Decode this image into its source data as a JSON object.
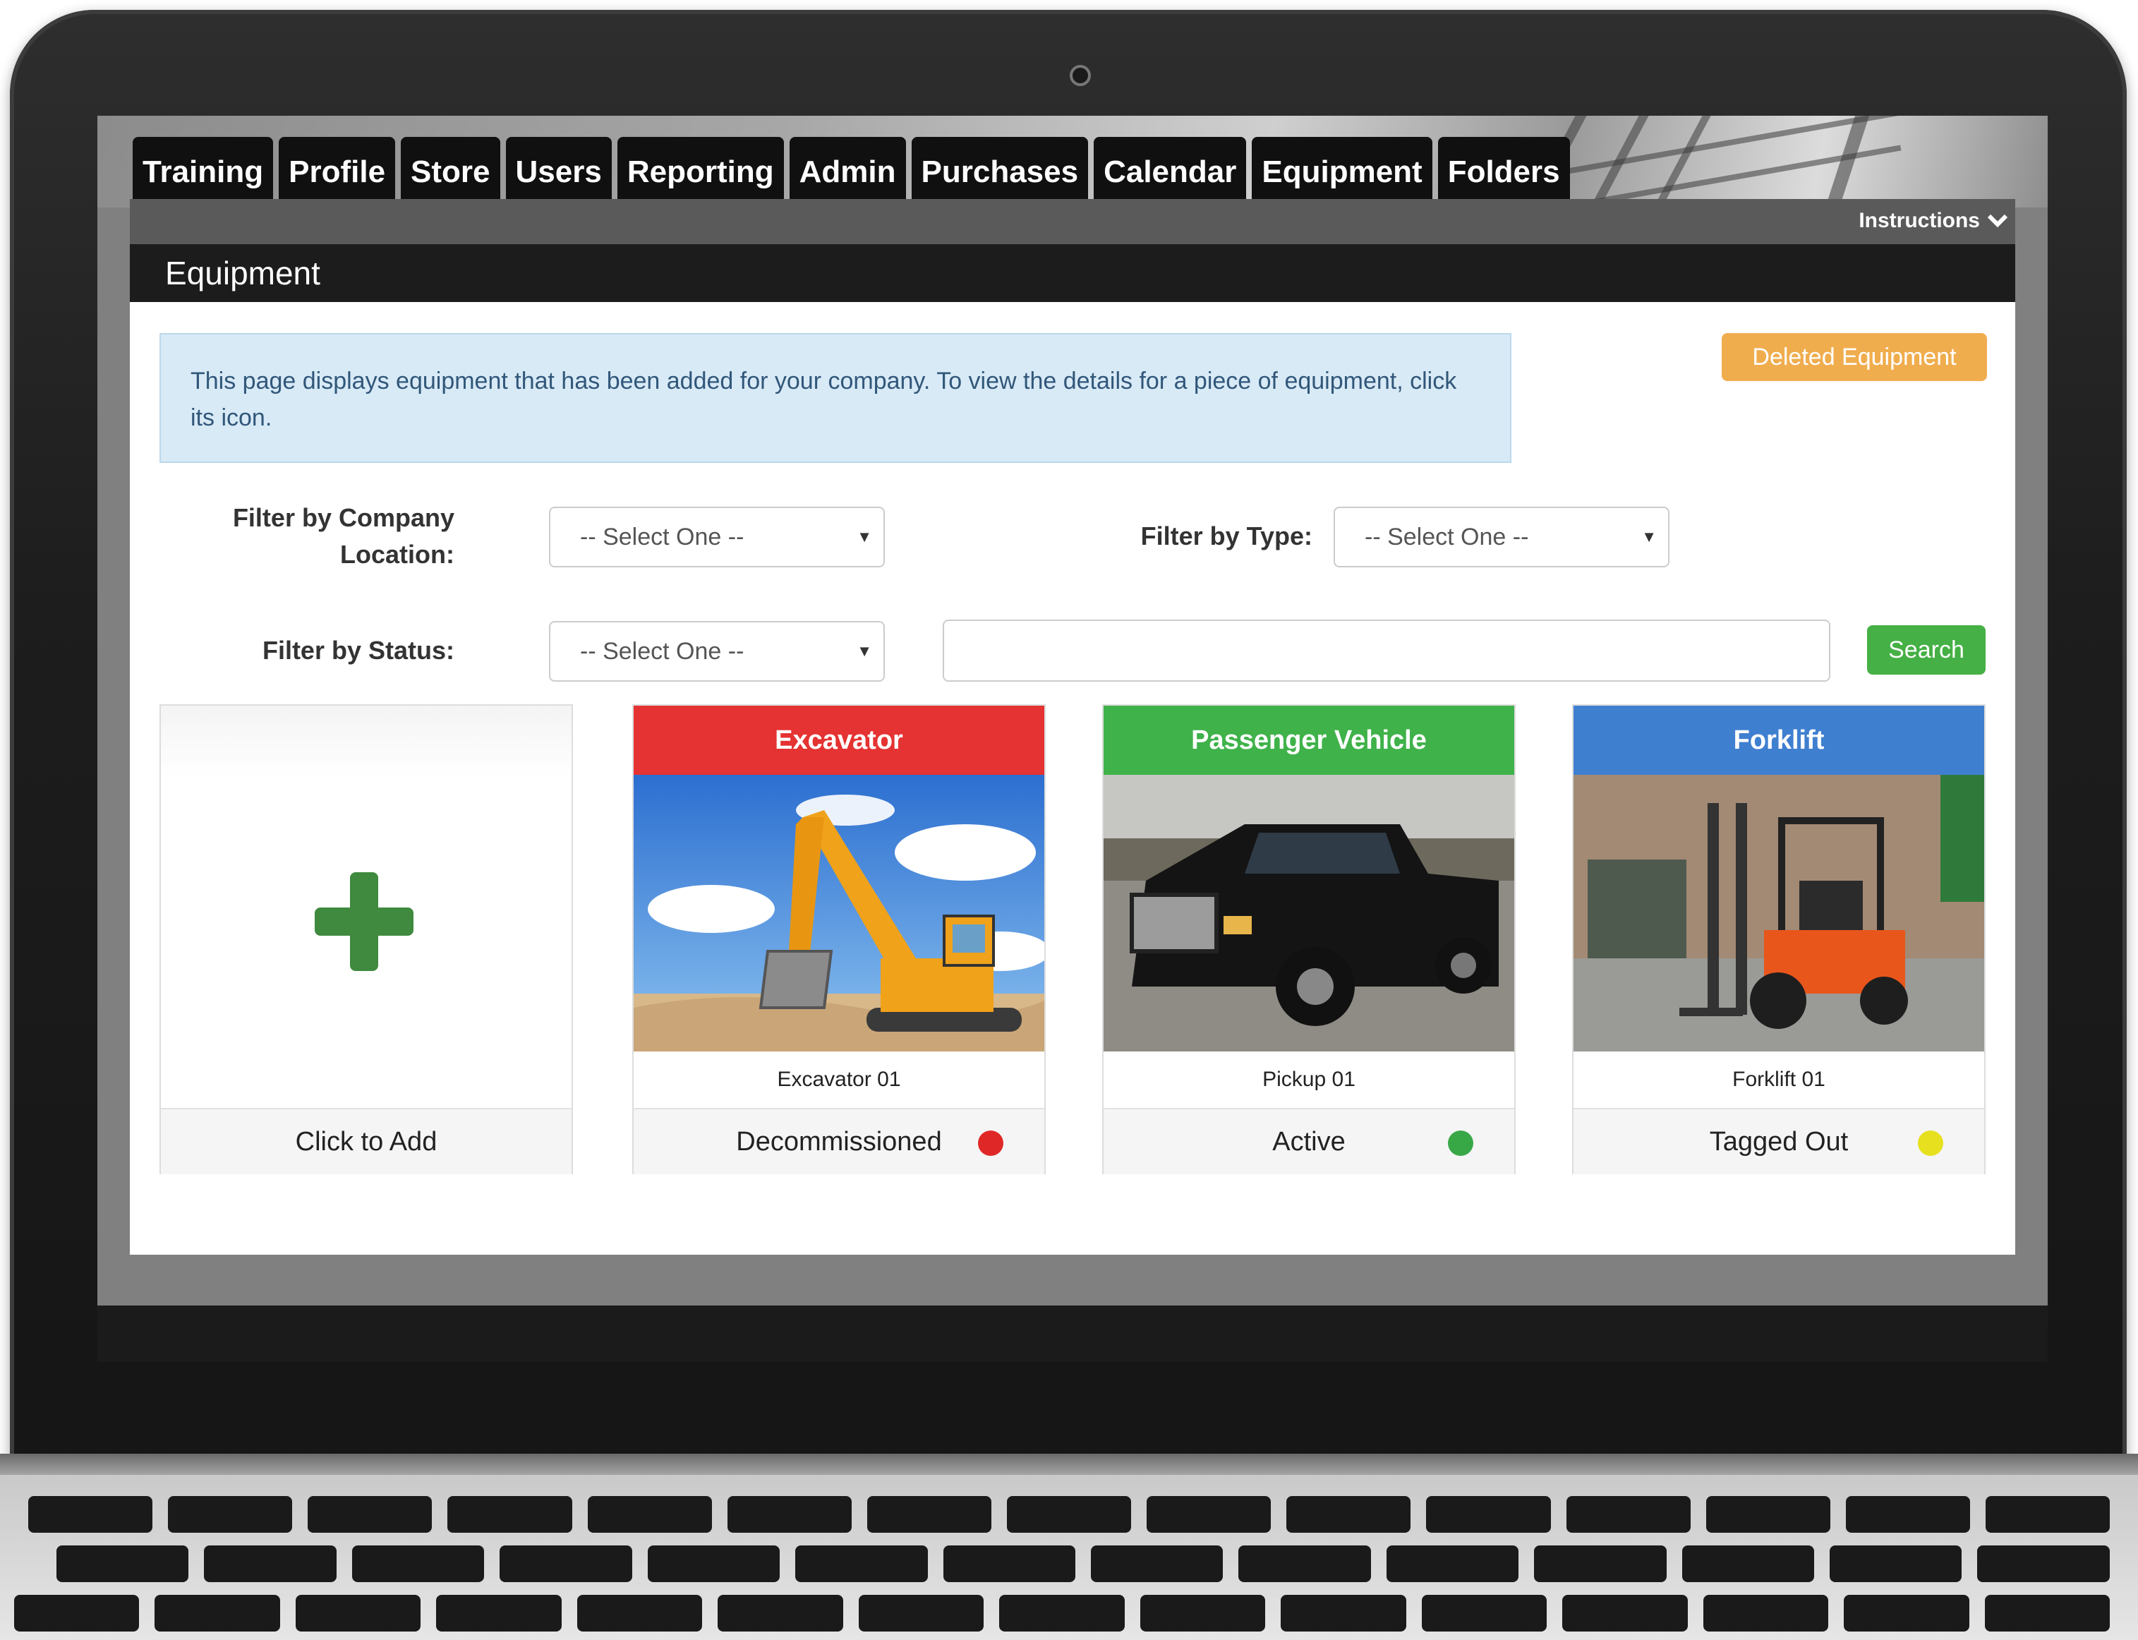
{
  "nav": {
    "tabs": [
      "Training",
      "Profile",
      "Store",
      "Users",
      "Reporting",
      "Admin",
      "Purchases",
      "Calendar",
      "Equipment",
      "Folders"
    ]
  },
  "header": {
    "instructions_label": "Instructions",
    "page_title": "Equipment"
  },
  "info": {
    "text": "This page displays equipment that has been added for your company. To view the details for a piece of equipment, click its icon."
  },
  "actions": {
    "deleted_equipment_label": "Deleted Equipment",
    "search_label": "Search",
    "search_value": ""
  },
  "filters": {
    "location": {
      "label": "Filter by Company Location:",
      "selected": "-- Select One --"
    },
    "type": {
      "label": "Filter by Type:",
      "selected": "-- Select One --"
    },
    "status": {
      "label": "Filter by Status:",
      "selected": "-- Select One --"
    }
  },
  "add_card": {
    "label": "Click to Add",
    "icon": "plus-icon",
    "icon_color": "#3f8a3f"
  },
  "equipment": [
    {
      "type": "Excavator",
      "name": "Excavator 01",
      "status": "Decommissioned",
      "header_color": "#e53232",
      "status_color": "#e02727"
    },
    {
      "type": "Passenger Vehicle",
      "name": "Pickup 01",
      "status": "Active",
      "header_color": "#3fb24a",
      "status_color": "#38a847"
    },
    {
      "type": "Forklift",
      "name": "Forklift 01",
      "status": "Tagged Out",
      "header_color": "#3f7fd0",
      "status_color": "#e6e01f"
    }
  ]
}
